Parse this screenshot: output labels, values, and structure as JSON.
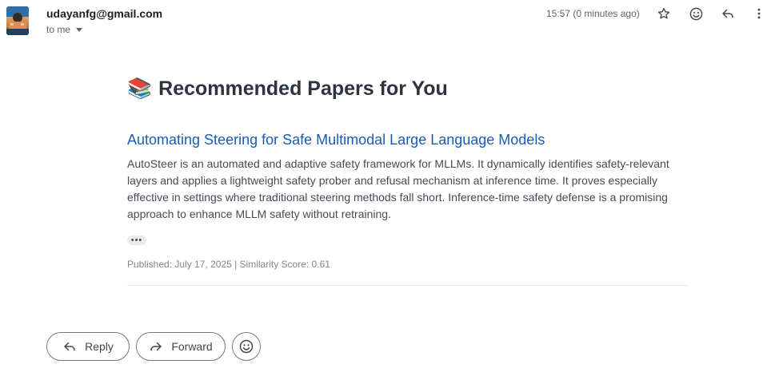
{
  "header": {
    "sender": "udayanfg@gmail.com",
    "recipient_label": "to me",
    "timestamp": "15:57 (0 minutes ago)",
    "icons": [
      "star-icon",
      "emoji-icon",
      "reply-icon",
      "more-vert-icon"
    ]
  },
  "email": {
    "heading_emoji": "📚",
    "heading": "Recommended Papers for You",
    "paper": {
      "title": "Automating Steering for Safe Multimodal Large Language Models",
      "abstract": "AutoSteer is an automated and adaptive safety framework for MLLMs. It dynamically identifies safety-relevant layers and applies a lightweight safety prober and refusal mechanism at inference time. It proves especially effective in settings where traditional steering methods fall short. Inference-time safety defense is a promising approach to enhance MLLM safety without retraining.",
      "meta": "Published: July 17, 2025 | Similarity Score: 0.61"
    },
    "collapsed_indicator": "•••"
  },
  "actions": {
    "reply_label": "Reply",
    "forward_label": "Forward"
  },
  "colors": {
    "link": "#1a5bb5",
    "heading": "#2c3440",
    "body_text": "#444b55",
    "meta_text": "#80868b"
  }
}
